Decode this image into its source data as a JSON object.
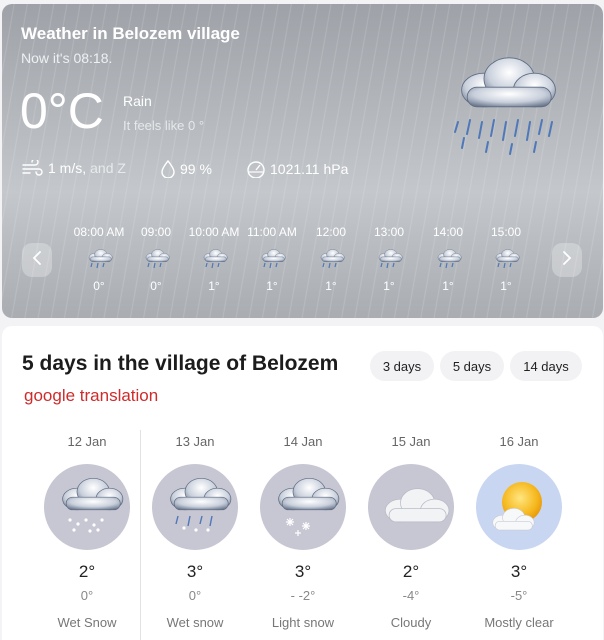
{
  "current": {
    "title": "Weather in Belozem village",
    "now": "Now it's 08:18.",
    "temperature": "0°C",
    "condition": "Rain",
    "feels_like": "It feels like 0 °",
    "wind_value": "1 m/s,",
    "wind_dir": "and Z",
    "humidity": "99 %",
    "pressure": "1021.11 hPa"
  },
  "hourly": [
    {
      "time": "08:00 AM",
      "temp": "0°",
      "icon": "rain-cloud-icon"
    },
    {
      "time": "09:00",
      "temp": "0°",
      "icon": "rain-cloud-icon"
    },
    {
      "time": "10:00 AM",
      "temp": "1°",
      "icon": "rain-cloud-icon"
    },
    {
      "time": "11:00 AM",
      "temp": "1°",
      "icon": "rain-cloud-icon"
    },
    {
      "time": "12:00",
      "temp": "1°",
      "icon": "rain-cloud-icon"
    },
    {
      "time": "13:00",
      "temp": "1°",
      "icon": "rain-cloud-icon"
    },
    {
      "time": "14:00",
      "temp": "1°",
      "icon": "rain-cloud-icon"
    },
    {
      "time": "15:00",
      "temp": "1°",
      "icon": "rain-cloud-icon"
    }
  ],
  "forecast": {
    "title": "5 days in the village of Belozem",
    "tabs": [
      "3 days",
      "5 days",
      "14 days"
    ],
    "translation_note": "google translation",
    "days": [
      {
        "date": "12 Jan",
        "high": "2°",
        "low": "0°",
        "desc": "Wet Snow",
        "icon": "wet-snow-icon"
      },
      {
        "date": "13 Jan",
        "high": "3°",
        "low": "0°",
        "desc": "Wet snow",
        "icon": "wet-snow-icon"
      },
      {
        "date": "14 Jan",
        "high": "3°",
        "low": "- -2°",
        "desc": "Light snow",
        "icon": "light-snow-icon"
      },
      {
        "date": "15 Jan",
        "high": "2°",
        "low": "-4°",
        "desc": "Cloudy",
        "icon": "cloud-icon"
      },
      {
        "date": "16 Jan",
        "high": "3°",
        "low": "-5°",
        "desc": "Mostly clear",
        "icon": "sun-cloud-icon"
      }
    ]
  },
  "colors": {
    "accent_red": "#cf2b2b",
    "circle_gray": "#c7c6d3",
    "circle_blue": "#c9d6f2",
    "sun": "#f4b400"
  }
}
